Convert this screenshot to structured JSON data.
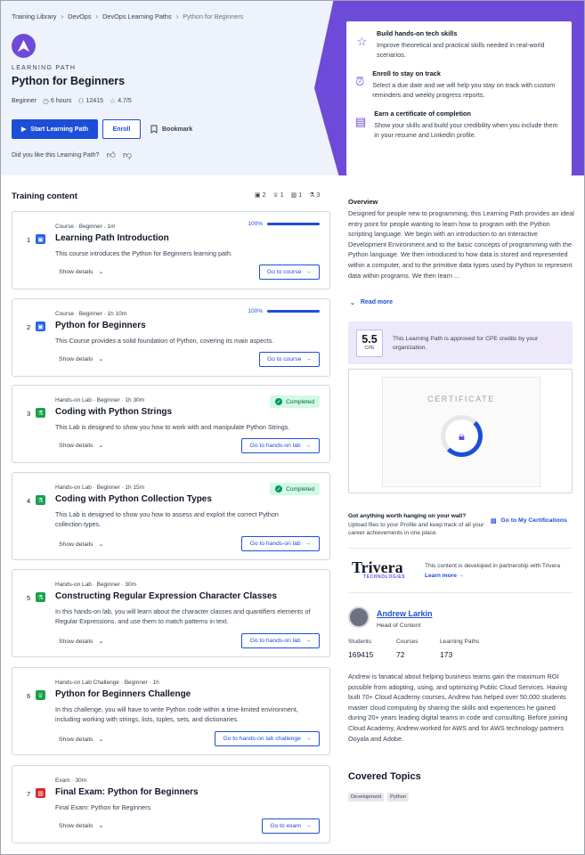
{
  "breadcrumb": {
    "items": [
      "Training Library",
      "DevOps",
      "DevOps Learning Paths"
    ],
    "current": "Python for Beginners"
  },
  "header": {
    "eyebrow": "LEARNING PATH",
    "title": "Python for Beginners",
    "level": "Beginner",
    "duration": "6 hours",
    "learners": "12415",
    "rating": "4.7/5",
    "start_label": "Start Learning Path",
    "enroll_label": "Enroll",
    "bookmark_label": "Bookmark",
    "like_question": "Did you like this Learning Path?"
  },
  "benefits": [
    {
      "icon": "star-icon",
      "title": "Build hands-on tech skills",
      "desc": "Improve theoretical and practical skills needed in real-world scenarios."
    },
    {
      "icon": "alarm-icon",
      "title": "Enroll to stay on track",
      "desc": "Select a due date and we will help you stay on track with custom reminders and weekly progress reports."
    },
    {
      "icon": "certificate-icon",
      "title": "Earn a certificate of completion",
      "desc": "Show your skills and build your credibility when you include them in your resume and LinkedIn profile."
    }
  ],
  "training": {
    "heading": "Training content",
    "counts": [
      "2",
      "1",
      "1",
      "3"
    ],
    "items": [
      {
        "num": "1",
        "type": "Course · Beginner · 1m",
        "title": "Learning Path Introduction",
        "desc": "This course introduces the Python for Beginners learning path.",
        "progress": "100%",
        "show": "Show details",
        "cta": "Go to course",
        "color": "#2563eb"
      },
      {
        "num": "2",
        "type": "Course · Beginner · 1h 10m",
        "title": "Python for Beginners",
        "desc": "This Course provides a solid foundation of Python, covering its main aspects.",
        "progress": "100%",
        "show": "Show details",
        "cta": "Go to course",
        "color": "#2563eb"
      },
      {
        "num": "3",
        "type": "Hands-on Lab · Beginner · 1h 30m",
        "title": "Coding with Python Strings",
        "desc": "This Lab is designed to show you how to work with and manipulate Python Strings.",
        "status": "Completed",
        "show": "Show details",
        "cta": "Go to hands-on lab",
        "color": "#16a34a"
      },
      {
        "num": "4",
        "type": "Hands-on Lab · Beginner · 1h 15m",
        "title": "Coding with Python Collection Types",
        "desc": "This Lab is designed to show you how to assess and exploit the correct Python collection types.",
        "status": "Completed",
        "show": "Show details",
        "cta": "Go to hands-on lab",
        "color": "#16a34a"
      },
      {
        "num": "5",
        "type": "Hands-on Lab · Beginner · 30m",
        "title": "Constructing Regular Expression Character Classes",
        "desc": "In this hands-on lab, you will learn about the character classes and quantifiers elements of Regular Expressions, and use them to match patterns in text.",
        "show": "Show details",
        "cta": "Go to hands-on lab",
        "color": "#16a34a"
      },
      {
        "num": "6",
        "type": "Hands-on Lab Challenge · Beginner · 1h",
        "title": "Python for Beginners Challenge",
        "desc": "In this challenge, you will have to write Python code within a time-limited environment, including working with strings, lists, tuples, sets, and dictionaries.",
        "show": "Show details",
        "cta": "Go to hands-on lab challenge",
        "color": "#16a34a"
      },
      {
        "num": "7",
        "type": "Exam · 30m",
        "title": "Final Exam: Python for Beginners",
        "desc": "Final Exam: Python for Beginners",
        "show": "Show details",
        "cta": "Go to exam",
        "color": "#dc2626"
      }
    ]
  },
  "overview": {
    "heading": "Overview",
    "text": "Designed for people new to programming, this Learning Path provides an ideal entry point for people wanting to learn how to program with the Python scripting language. We begin with an introduction to an Interactive Development Environment and to the basic concepts of programming with the Python language. We then introduced to how data is stored and represented within a computer, and to the primitive data types used by Python to represent data within programs. We then learn ...",
    "read_more": "Read more"
  },
  "cpe": {
    "value": "5.5",
    "unit": "CPE",
    "text": "This Learning Path is approved for CPE credits by your organization."
  },
  "certificate": {
    "title": "CERTIFICATE"
  },
  "wall": {
    "title": "Got anything worth hanging on your wall?",
    "text": "Upload files to your Profile and keep track of all your career achievements in one place.",
    "link": "Go to My Certifications"
  },
  "partner": {
    "name": "Trivera",
    "sub": "TECHNOLOGIES",
    "text": "This content is developed in partnership with Trivera",
    "link": "Learn more"
  },
  "author": {
    "name": "Andrew Larkin",
    "role": "Head of Content",
    "stats": [
      {
        "label": "Students",
        "value": "169415"
      },
      {
        "label": "Courses",
        "value": "72"
      },
      {
        "label": "Learning Paths",
        "value": "173"
      }
    ],
    "bio": "Andrew is fanatical about helping business teams gain the maximum ROI possible from adopting, using, and optimizing Public Cloud Services. Having built 70+ Cloud Academy courses, Andrew has helped over 50,000 students master cloud computing by sharing the skills and experiences he gained during 20+ years leading digital teams in code and consulting. Before joining Cloud Academy, Andrew worked for AWS and for AWS technology partners Ooyala and Adobe."
  },
  "topics": {
    "heading": "Covered Topics",
    "tags": [
      "Development",
      "Python"
    ]
  }
}
